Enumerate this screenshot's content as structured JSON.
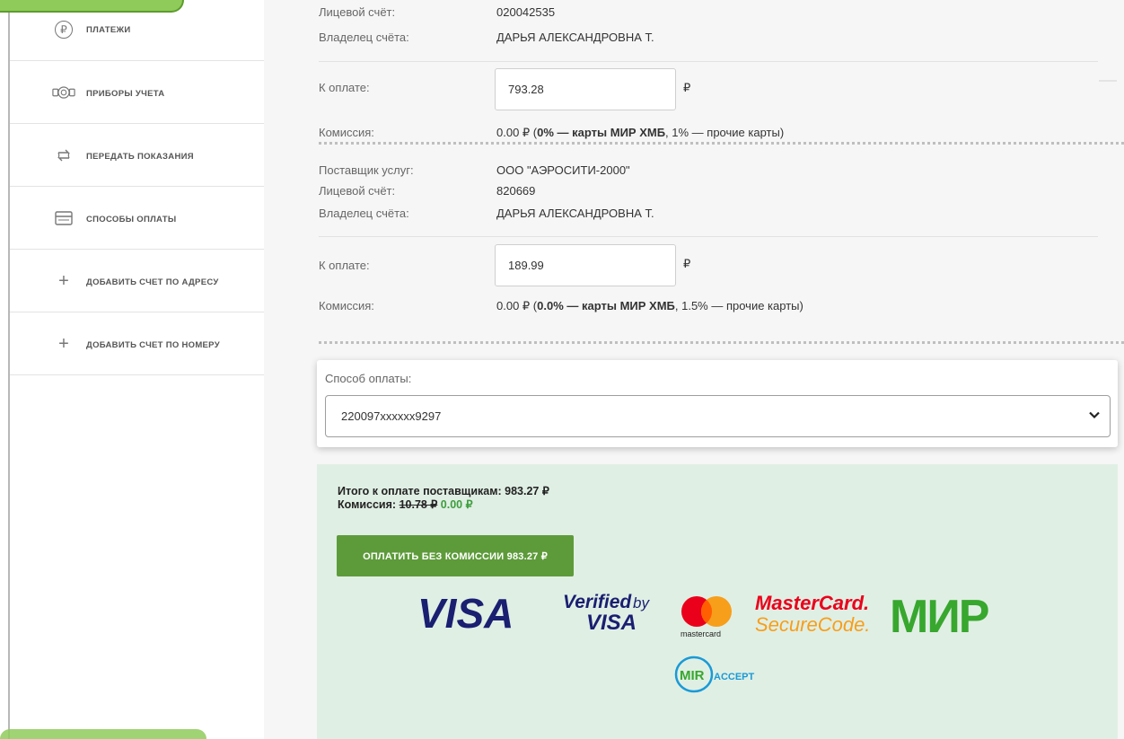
{
  "sidebar": {
    "items": [
      {
        "label": "Платежи",
        "icon": "ruble-icon"
      },
      {
        "label": "Приборы учета",
        "icon": "meter-icon"
      },
      {
        "label": "Передать показания",
        "icon": "refresh-icon"
      },
      {
        "label": "Способы оплаты",
        "icon": "wallet-icon"
      },
      {
        "label": "Добавить счет по адресу",
        "icon": "plus-icon"
      },
      {
        "label": "Добавить счет по номеру",
        "icon": "plus-icon"
      }
    ]
  },
  "account1": {
    "account_label": "Лицевой счёт:",
    "account_value": "020042535",
    "owner_label": "Владелец счёта:",
    "owner_value": "ДАРЬЯ АЛЕКСАНДРОВНА Т.",
    "pay_label": "К оплате:",
    "pay_value": "793.28",
    "currency": "₽",
    "commission_label": "Комиссия:",
    "commission_amount": "0.00 ₽ (",
    "commission_bold": "0% — карты МИР ХМБ",
    "commission_rest": ", 1% — прочие карты)"
  },
  "account2": {
    "provider_label": "Поставщик услуг:",
    "provider_value": "ООО \"АЭРОСИТИ-2000\"",
    "account_label": "Лицевой счёт:",
    "account_value": "820669",
    "owner_label": "Владелец счёта:",
    "owner_value": "ДАРЬЯ АЛЕКСАНДРОВНА Т.",
    "pay_label": "К оплате:",
    "pay_value": "189.99",
    "currency": "₽",
    "commission_label": "Комиссия:",
    "commission_amount": "0.00 ₽ (",
    "commission_bold": "0.0% — карты МИР ХМБ",
    "commission_rest": ", 1.5% — прочие карты)"
  },
  "payment_method": {
    "label": "Способ оплаты:",
    "selected": "220097xxxxxx9297"
  },
  "total": {
    "total_text": "Итого к оплате поставщикам: 983.27 ₽",
    "commission_label": "Комиссия:",
    "commission_old": "10.78 ₽",
    "commission_new": "0.00 ₽",
    "pay_button": "ОПЛАТИТЬ БЕЗ КОМИССИИ 983.27 ₽"
  },
  "logos": {
    "visa": "VISA",
    "verified_top": "Verified",
    "verified_by": "by",
    "verified_visa": "VISA",
    "mastercard_small": "mastercard",
    "mc_secure_top": "MasterCard.",
    "mc_secure_bottom": "SecureCode.",
    "mir": "МИР",
    "mir_accept_mi": "MIR",
    "mir_accept_rest": "ACCEPT"
  },
  "colors": {
    "accent_green": "#5d9b3a",
    "total_bg": "#e0efe4",
    "visa_blue": "#1a1f71",
    "mir_green": "#37a72e",
    "mc_red": "#eb001b",
    "mc_orange": "#f79e1b"
  }
}
